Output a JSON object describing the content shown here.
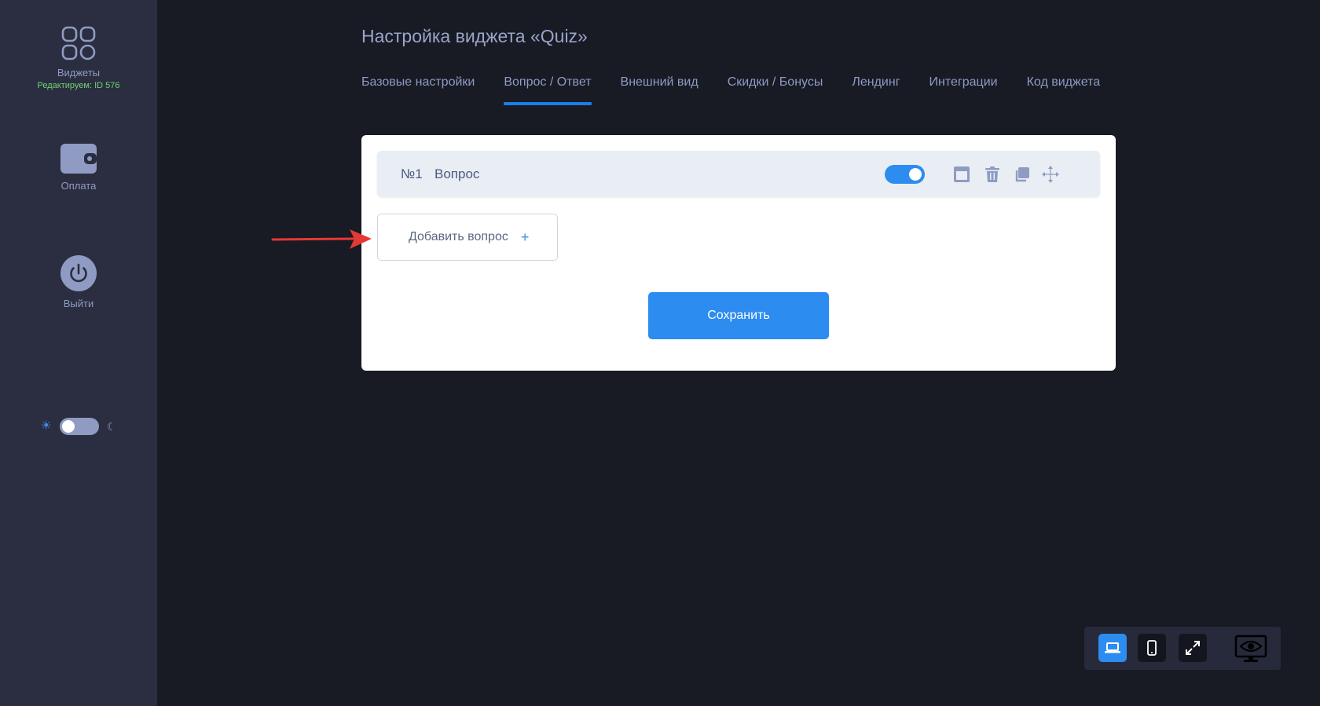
{
  "sidebar": {
    "widgets_label": "Виджеты",
    "editing_label": "Редактируем: ID 576",
    "payment_label": "Оплата",
    "logout_label": "Выйти"
  },
  "page": {
    "title": "Настройка виджета «Quiz»"
  },
  "tabs": [
    {
      "label": "Базовые настройки"
    },
    {
      "label": "Вопрос / Ответ"
    },
    {
      "label": "Внешний вид"
    },
    {
      "label": "Скидки / Бонусы"
    },
    {
      "label": "Лендинг"
    },
    {
      "label": "Интеграции"
    },
    {
      "label": "Код виджета"
    }
  ],
  "active_tab": "Вопрос / Ответ",
  "question": {
    "number": "№1",
    "text": "Вопрос",
    "enabled": true
  },
  "buttons": {
    "add_question": "Добавить вопрос",
    "add_plus": "+",
    "save": "Сохранить"
  },
  "theme": {
    "dark_mode": false
  },
  "device_toolbar": {
    "active": "desktop"
  },
  "colors": {
    "accent": "#2d8cf0",
    "tab_underline": "#1a7ee6",
    "editing_green": "#6ed46e",
    "annotation_arrow": "#e53935"
  }
}
